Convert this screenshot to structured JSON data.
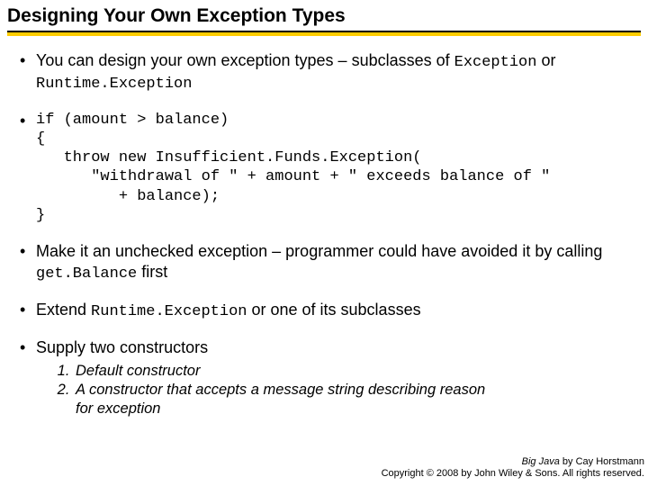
{
  "title": "Designing Your Own Exception Types",
  "bullet1": {
    "text_before": "You can design your own exception types – subclasses of ",
    "code1": "Exception",
    "or": " or ",
    "code2": "Runtime.Exception"
  },
  "codeblock": "if (amount > balance)\n{\n   throw new Insufficient.Funds.Exception(\n      \"withdrawal of \" + amount + \" exceeds balance of \"\n         + balance);\n}",
  "bullet3": {
    "pre": "Make it an unchecked exception – programmer could have avoided it by calling ",
    "code": "get.Balance",
    "post": " first"
  },
  "bullet4": {
    "pre": "Extend ",
    "code": "Runtime.Exception",
    "post": " or one of its subclasses"
  },
  "bullet5": "Supply two constructors",
  "numbered": [
    "Default constructor",
    "A constructor that accepts a message string describing reason for exception"
  ],
  "footer": {
    "book": "Big Java",
    "byline": " by Cay Horstmann",
    "copyright": "Copyright © 2008 by John Wiley & Sons.  All rights reserved."
  }
}
